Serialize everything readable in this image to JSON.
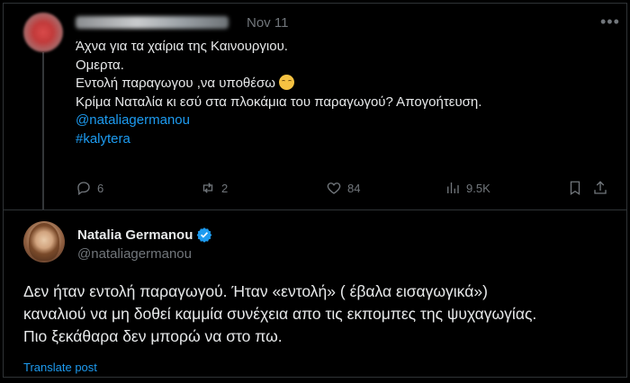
{
  "parent_tweet": {
    "date": "Nov 11",
    "lines": [
      "Άχνα για τα χαίρια της Καινουργιου.",
      "Ομερτα.",
      "Εντολή παραγωγου ,να υποθέσω",
      "Κρίμα Ναταλία κι εσύ στα πλοκάμια του παραγωγού? Απογοήτευση."
    ],
    "emoji": "relieved-face-emoji",
    "mention": "@nataliagermanou",
    "hashtag": "#kalytera",
    "stats": {
      "replies": "6",
      "reposts": "2",
      "likes": "84",
      "views": "9.5K"
    }
  },
  "reply_tweet": {
    "author_name": "Natalia Germanou",
    "handle": "@nataliagermanou",
    "verified_color": "#1d9bf0",
    "lines": [
      "Δεν ήταν εντολή παραγωγού. Ήταν «εντολή» ( έβαλα εισαγωγικά»)",
      "καναλιού να μη δοθεί καμμία συνέχεια απο τις εκπομπες της ψυχαγωγίας.",
      "Πιο ξεκάθαρα δεν μπορώ να στο πω."
    ],
    "translate_label": "Translate post"
  },
  "colors": {
    "background": "#000000",
    "text": "#e7e9ea",
    "secondary_text": "#71767b",
    "link": "#1d9bf0",
    "divider": "#2f3336"
  }
}
